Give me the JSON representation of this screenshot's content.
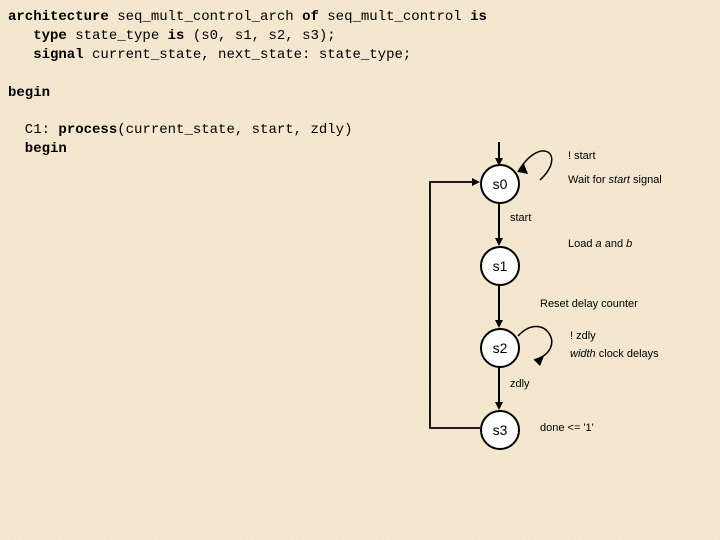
{
  "code": {
    "l1a": "architecture",
    "l1b": " seq_mult_control_arch ",
    "l1c": "of",
    "l1d": " seq_mult_control ",
    "l1e": "is",
    "l2a": "   type",
    "l2b": " state_type ",
    "l2c": "is",
    "l2d": " (s0, s1, s2, s3);",
    "l3a": "   signal",
    "l3b": " current_state, next_state: state_type;",
    "l4": "",
    "l5": "begin",
    "l6": "",
    "l7a": "  C1: ",
    "l7b": "process",
    "l7c": "(current_state, start, zdly)",
    "l8": "  begin"
  },
  "states": {
    "s0": "s0",
    "s1": "s1",
    "s2": "s2",
    "s3": "s3"
  },
  "edges": {
    "not_start": "! start",
    "wait": "Wait for ",
    "wait_em": "start",
    "wait2": " signal",
    "start": "start",
    "load": "Load ",
    "load_a": "a",
    "load_mid": " and ",
    "load_b": "b",
    "reset": "Reset delay counter",
    "not_zdly": "! zdly",
    "width": "width",
    "width2": " clock delays",
    "zdly": "zdly",
    "done": "done <= '1'"
  }
}
